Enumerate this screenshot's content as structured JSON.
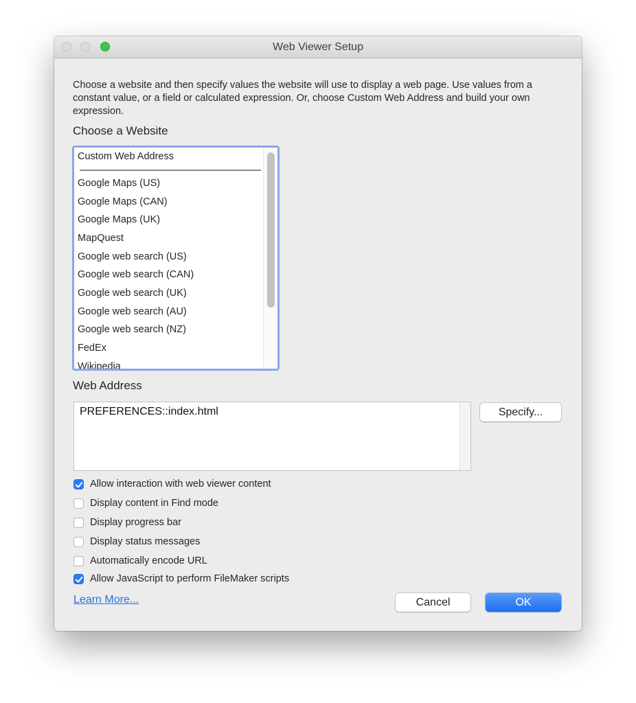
{
  "window": {
    "title": "Web Viewer Setup"
  },
  "description": "Choose a website and then specify values the website will use to display a web page. Use values from a constant value, or a field or calculated expression. Or, choose Custom Web Address and build your own expression.",
  "website_section": {
    "label": "Choose a Website",
    "items": [
      "Custom Web Address",
      "Google Maps (US)",
      "Google Maps (CAN)",
      "Google Maps (UK)",
      "MapQuest",
      "Google web search (US)",
      "Google web search (CAN)",
      "Google web search (UK)",
      "Google web search (AU)",
      "Google web search (NZ)",
      "FedEx",
      "Wikipedia"
    ]
  },
  "address_section": {
    "label": "Web Address",
    "value": "PREFERENCES::index.html",
    "specify_label": "Specify..."
  },
  "options": [
    {
      "label": "Allow interaction with web viewer content",
      "checked": true
    },
    {
      "label": "Display content in Find mode",
      "checked": false
    },
    {
      "label": "Display progress bar",
      "checked": false
    },
    {
      "label": "Display status messages",
      "checked": false
    },
    {
      "label": "Automatically encode URL",
      "checked": false
    },
    {
      "label": "Allow JavaScript to perform FileMaker scripts",
      "checked": true
    }
  ],
  "footer": {
    "learn_more": "Learn More...",
    "cancel_label": "Cancel",
    "ok_label": "OK"
  },
  "colors": {
    "accent": "#2f7bf5",
    "focus_ring": "#86a8ea",
    "link": "#2f6fd8"
  }
}
